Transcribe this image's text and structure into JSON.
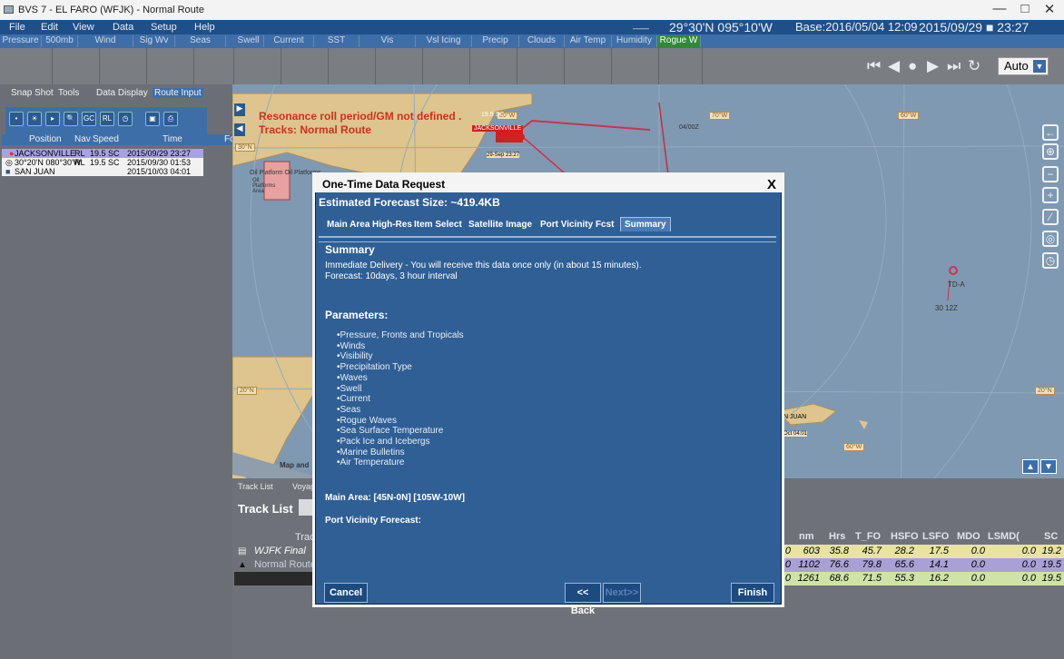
{
  "window": {
    "title": "BVS 7 - EL FARO (WFJK) - Normal Route",
    "controls": [
      "—",
      "□",
      "✕"
    ]
  },
  "menu": {
    "items": [
      "File",
      "Edit",
      "View",
      "Data",
      "Setup",
      "Help"
    ],
    "position": "29°30'N 095°10'W",
    "base": "Base:2016/05/04 12:09",
    "time": "2015/09/29 ■ 23:27",
    "dash": "——"
  },
  "layer_tabs": [
    "Pressure",
    "500mb",
    "Wind",
    "Sig Wv",
    "Seas",
    "Swell",
    "Current",
    "SST",
    "Vis",
    "Vsl Icing",
    "Precip",
    "Clouds",
    "Air Temp",
    "Humidity",
    "Rogue W"
  ],
  "playback": {
    "auto_label": "Auto",
    "dropdown_icon": "▼"
  },
  "left_panel": {
    "tabs": [
      "Snap Shot",
      "Tools",
      "Data Display",
      "Route Input"
    ],
    "icon_labels": [
      "GC",
      "RL"
    ],
    "headers": [
      "Position",
      "Nav",
      "Speed",
      "Time",
      "Fc"
    ],
    "rows": [
      {
        "position": "JACKSONVILLE",
        "nav": "RL",
        "speed": "19.5 SC",
        "time": "2015/09/29 23:27"
      },
      {
        "position": "30°20'N 080°30'W",
        "nav": "RL",
        "speed": "19.5 SC",
        "time": "2015/09/30 01:53"
      },
      {
        "position": "SAN JUAN",
        "nav": "",
        "speed": "",
        "time": "2015/10/03 04:01"
      }
    ]
  },
  "map": {
    "warning": "Resonance roll period/GM not defined .",
    "tracks_label": "Tracks: Normal Route",
    "labels": {
      "jacksonville": "JACKSONVILLE",
      "speed_tag": "19.5 SC",
      "deg80": "80°W",
      "deg70": "70°W",
      "deg60": "60°W",
      "deg60b": "60°W",
      "lat30": "30°N",
      "lat20": "20°N",
      "lat20b": "20°N",
      "sep": "29-Sep 23:27",
      "z0400": "04/00Z",
      "oil1": "Oil Platform Oil Platforms",
      "oil2": "Oil Platforms Area",
      "tda": "TD-A",
      "t3012": "30 12Z",
      "sanjuan": "N JUAN",
      "oct": "Oct 04:01",
      "mapand": "Map and"
    }
  },
  "bottom_panel": {
    "tabs": [
      "Track List",
      "Voyag"
    ],
    "title": "Track List",
    "track_header": "Track",
    "tracks": [
      "WJFK Final",
      "Normal Route"
    ],
    "headers": [
      "nm",
      "Hrs",
      "T_FO",
      "HSFO",
      "LSFO",
      "MDO",
      "LSMD(",
      "SC"
    ],
    "rows": [
      [
        "0",
        "603",
        "35.8",
        "45.7",
        "28.2",
        "17.5",
        "0.0",
        "0.0",
        "19.2"
      ],
      [
        "0",
        "1102",
        "76.6",
        "79.8",
        "65.6",
        "14.1",
        "0.0",
        "0.0",
        "19.5"
      ],
      [
        "0",
        "1261",
        "68.6",
        "71.5",
        "55.3",
        "16.2",
        "0.0",
        "0.0",
        "19.5"
      ]
    ]
  },
  "dialog": {
    "title": "One-Time Data Request",
    "close": "X",
    "size": "Estimated Forecast Size: ~419.4KB",
    "tabs": [
      "Main Area",
      "High-Res",
      "Item Select",
      "Satellite Image",
      "Port Vicinity Fcst",
      "Summary"
    ],
    "summary_heading": "Summary",
    "delivery": "Immediate Delivery - You will receive this data once only (in about 15 minutes).",
    "forecast": "Forecast: 10days, 3 hour interval",
    "params_heading": "Parameters:",
    "params": [
      "Pressure, Fronts and Tropicals",
      "Winds",
      "Visibility",
      "Precipitation Type",
      "Waves",
      "Swell",
      "Current",
      "Seas",
      "Rogue Waves",
      "Sea Surface Temperature",
      "Pack Ice and Icebergs",
      "Marine Bulletins",
      "Air Temperature"
    ],
    "main_area": "Main Area: [45N-0N] [105W-10W]",
    "port_vicinity": "Port Vicinity Forecast:",
    "buttons": {
      "cancel": "Cancel",
      "back": "<< Back",
      "next": "Next>>",
      "finish": "Finish"
    }
  }
}
